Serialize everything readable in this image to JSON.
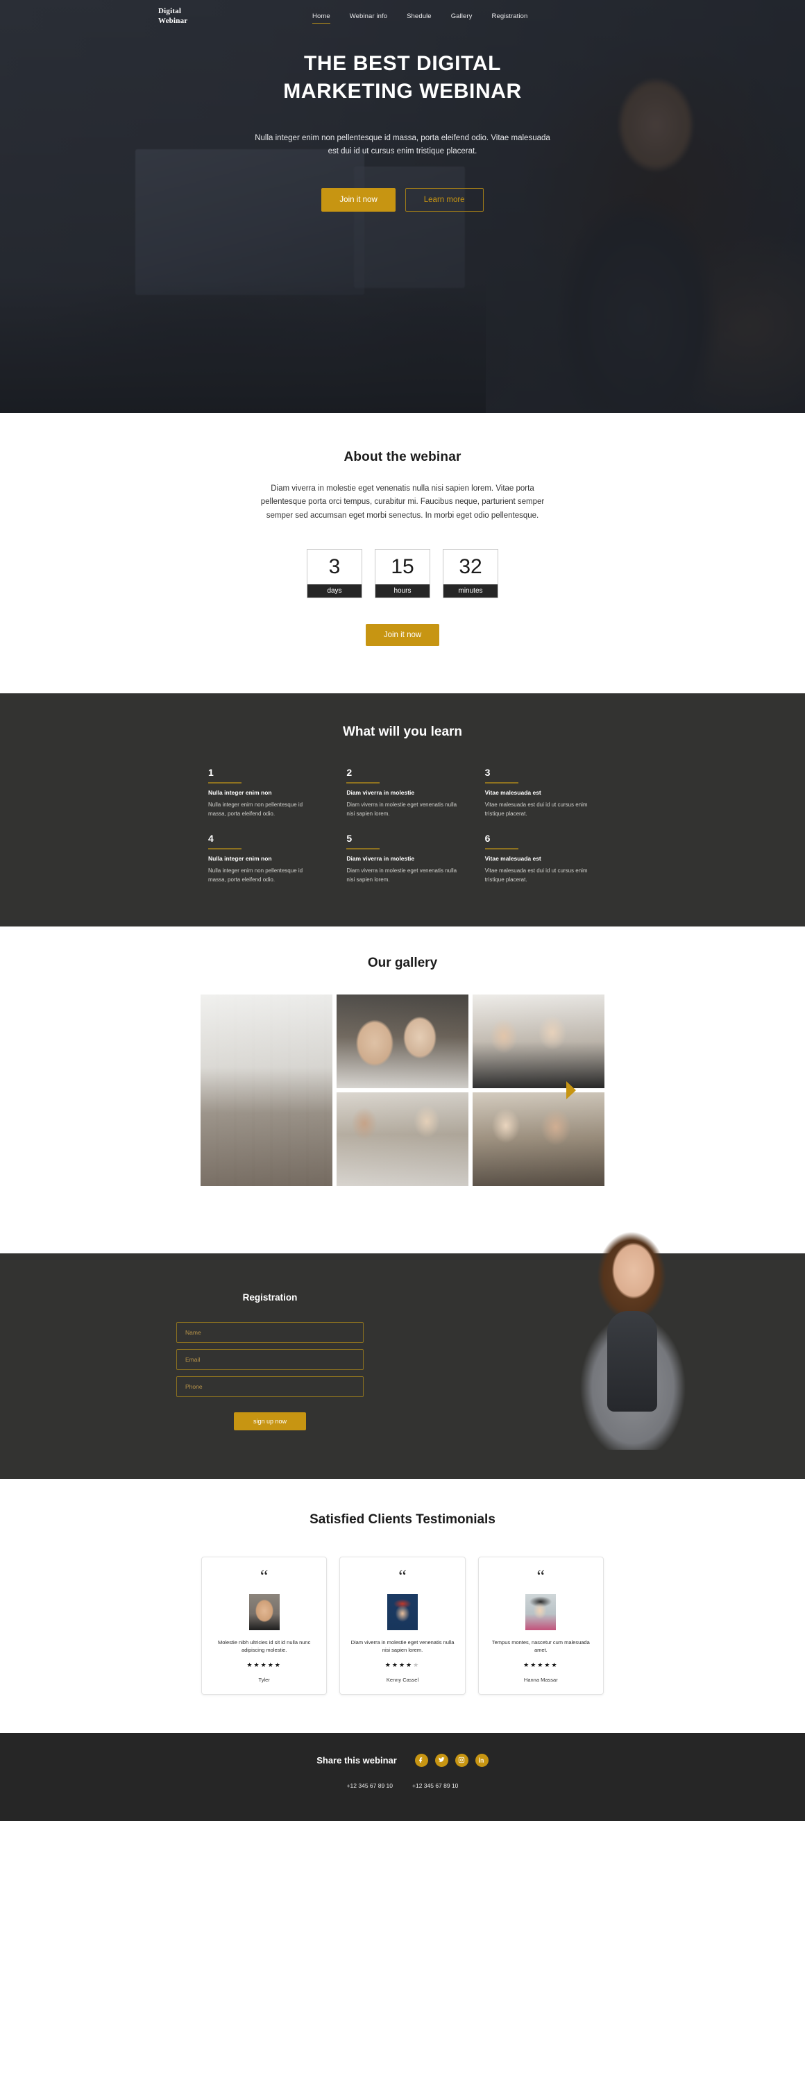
{
  "brand": {
    "line1": "Digital",
    "line2": "Webinar",
    "accent": "#c79512"
  },
  "nav": {
    "items": [
      {
        "label": "Home",
        "active": true
      },
      {
        "label": "Webinar info",
        "active": false
      },
      {
        "label": "Shedule",
        "active": false
      },
      {
        "label": "Gallery",
        "active": false
      },
      {
        "label": "Registration",
        "active": false
      }
    ]
  },
  "hero": {
    "title_line1": "THE BEST DIGITAL",
    "title_line2": "MARKETING WEBINAR",
    "paragraph": "Nulla integer enim non pellentesque id massa, porta eleifend odio. Vitae malesuada est dui id ut cursus enim tristique placerat.",
    "primary_button": "Join it now",
    "secondary_button": "Learn more"
  },
  "about": {
    "title": "About the webinar",
    "paragraph": "Diam viverra in molestie eget venenatis nulla nisi sapien lorem. Vitae porta pellentesque porta orci tempus, curabitur mi. Faucibus neque, parturient semper semper sed accumsan eget morbi senectus. In morbi eget odio pellentesque.",
    "countdown": [
      {
        "value": "3",
        "label": "days"
      },
      {
        "value": "15",
        "label": "hours"
      },
      {
        "value": "32",
        "label": "minutes"
      }
    ],
    "cta": "Join it now"
  },
  "learn": {
    "title": "What will you learn",
    "items": [
      {
        "num": "1",
        "head": "Nulla integer enim non",
        "body": "Nulla integer enim non pellentesque id massa, porta eleifend odio."
      },
      {
        "num": "2",
        "head": "Diam viverra in molestie",
        "body": "Diam viverra in molestie eget venenatis nulla nisi sapien lorem."
      },
      {
        "num": "3",
        "head": "Vitae malesuada est",
        "body": "Vitae malesuada est dui id ut cursus enim tristique placerat."
      },
      {
        "num": "4",
        "head": "Nulla integer enim non",
        "body": "Nulla integer enim non pellentesque id massa, porta eleifend odio."
      },
      {
        "num": "5",
        "head": "Diam viverra in molestie",
        "body": "Diam viverra in molestie eget venenatis nulla nisi sapien lorem."
      },
      {
        "num": "6",
        "head": "Vitae malesuada est",
        "body": "Vitae malesuada est dui id ut cursus enim tristique placerat."
      }
    ]
  },
  "gallery": {
    "title": "Our gallery",
    "prev_icon": "arrow-left-icon",
    "next_icon": "arrow-right-icon",
    "images": [
      {
        "alt": "long office table meeting"
      },
      {
        "alt": "team around laptop"
      },
      {
        "alt": "group smiling at laptop"
      },
      {
        "alt": "three colleagues with laptop"
      },
      {
        "alt": "two people working on laptops"
      }
    ]
  },
  "registration": {
    "title": "Registration",
    "fields": [
      {
        "name": "name",
        "placeholder": "Name",
        "value": ""
      },
      {
        "name": "email",
        "placeholder": "Email",
        "value": ""
      },
      {
        "name": "phone",
        "placeholder": "Phone",
        "value": ""
      }
    ],
    "submit": "sign up now",
    "person_alt": "woman in grey suit"
  },
  "testimonials": {
    "title": "Satisfied Clients Testimonials",
    "quote_glyph": "“",
    "items": [
      {
        "text": "Molestie nibh ultricies id sit id nulla nunc adipiscing molestie.",
        "rating": 5,
        "name": "Tyler"
      },
      {
        "text": "Diam viverra in molestie eget venenatis nulla nisi sapien lorem.",
        "rating": 4,
        "name": "Kenny Cassel"
      },
      {
        "text": "Tempus montes, nascetur cum malesuada amet.",
        "rating": 5,
        "name": "Hanna Massar"
      }
    ]
  },
  "footer": {
    "share_label": "Share this webinar",
    "socials": [
      {
        "name": "facebook-icon"
      },
      {
        "name": "twitter-icon"
      },
      {
        "name": "instagram-icon"
      },
      {
        "name": "linkedin-icon"
      }
    ],
    "phones": [
      "+12 345 67 89 10",
      "+12 345 67 89 10"
    ]
  }
}
